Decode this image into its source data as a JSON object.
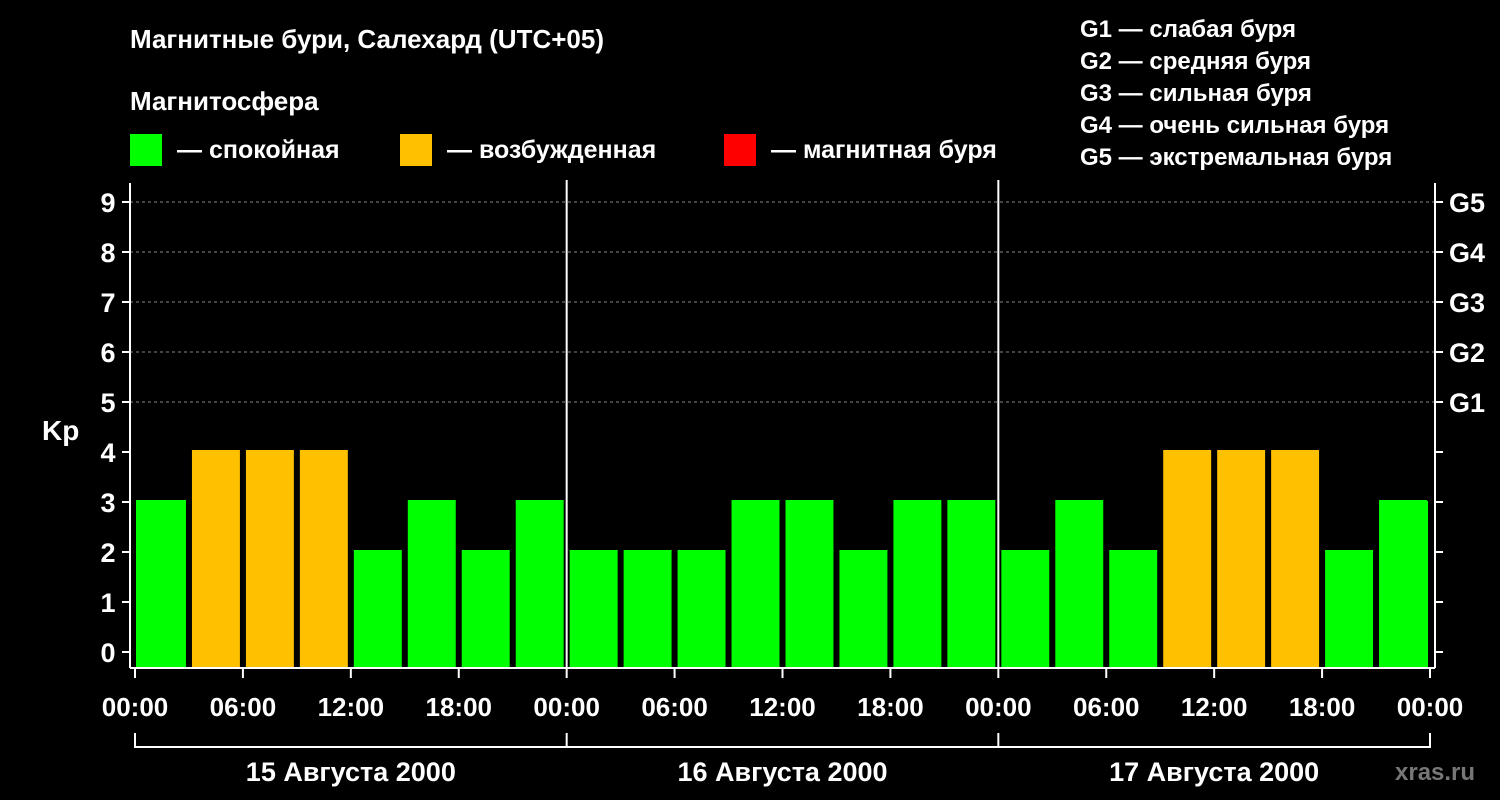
{
  "header": {
    "title": "Магнитные бури, Салехард (UTC+05)",
    "subtitle": "Магнитосфера",
    "legend": [
      {
        "color": "#00ff00",
        "label": "— спокойная"
      },
      {
        "color": "#ffc000",
        "label": "— возбужденная"
      },
      {
        "color": "#ff0000",
        "label": "— магнитная буря"
      }
    ],
    "storm_scale": [
      "G1 — слабая буря",
      "G2 — средняя буря",
      "G3 — сильная буря",
      "G4 — очень сильная буря",
      "G5 — экстремальная буря"
    ]
  },
  "watermark": "xras.ru",
  "chart_data": {
    "type": "bar",
    "ylabel": "Kp",
    "ylim": [
      0,
      9
    ],
    "y_ticks": [
      "0",
      "1",
      "2",
      "3",
      "4",
      "5",
      "6",
      "7",
      "8",
      "9"
    ],
    "right_ticks": [
      {
        "kp": 5,
        "label": "G1"
      },
      {
        "kp": 6,
        "label": "G2"
      },
      {
        "kp": 7,
        "label": "G3"
      },
      {
        "kp": 8,
        "label": "G4"
      },
      {
        "kp": 9,
        "label": "G5"
      }
    ],
    "grid": "dashed horizontal at 5-9",
    "x_tick_labels": [
      "00:00",
      "06:00",
      "12:00",
      "18:00",
      "00:00",
      "06:00",
      "12:00",
      "18:00",
      "00:00",
      "06:00",
      "12:00",
      "18:00",
      "00:00"
    ],
    "days": [
      "15 Августа 2000",
      "16 Августа 2000",
      "17 Августа 2000"
    ],
    "interval_hours": 3,
    "values": [
      3,
      4,
      4,
      4,
      2,
      3,
      2,
      3,
      2,
      2,
      2,
      3,
      3,
      2,
      3,
      3,
      2,
      3,
      2,
      4,
      4,
      4,
      2,
      3
    ],
    "colors": {
      "quiet": "#00ff00",
      "active": "#ffc000",
      "storm": "#ff0000"
    }
  }
}
